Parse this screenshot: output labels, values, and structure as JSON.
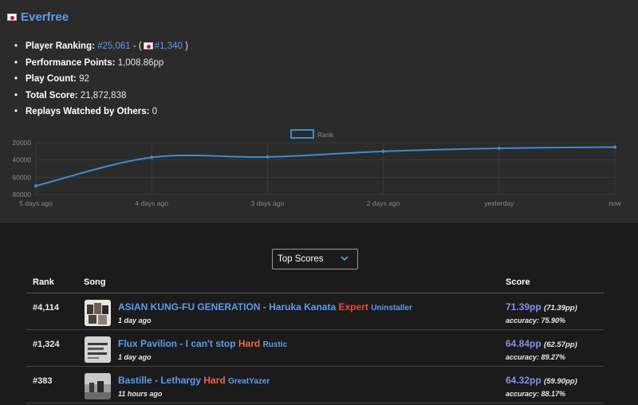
{
  "player": {
    "name": "Everfree",
    "stats": {
      "ranking_label": "Player Ranking:",
      "global_rank": "#25,061",
      "sep": " - (",
      "country_rank": "#1,340",
      "close": " )",
      "pp_label": "Performance Points:",
      "pp_value": "1,008.86pp",
      "playcount_label": "Play Count:",
      "playcount_value": "92",
      "score_label": "Total Score:",
      "score_value": "21,872,838",
      "replays_label": "Replays Watched by Others:",
      "replays_value": "0"
    }
  },
  "chart_data": {
    "type": "line",
    "title": "",
    "legend": [
      "Rank"
    ],
    "legend_placement": "top-center",
    "x": [
      "5 days ago",
      "4 days ago",
      "3 days ago",
      "2 days ago",
      "yesterday",
      "now"
    ],
    "series": [
      {
        "name": "Rank",
        "values": [
          70000,
          37000,
          36500,
          30000,
          26500,
          25061
        ]
      }
    ],
    "y_ticks": [
      20000,
      40000,
      60000,
      80000
    ],
    "ylim": [
      20000,
      80000
    ],
    "y_reversed": true,
    "grid": true,
    "line_color": "#3d8bd0"
  },
  "controls": {
    "dropdown_label": "Top Scores"
  },
  "table": {
    "headers": {
      "rank": "Rank",
      "song": "Song",
      "score": "Score"
    },
    "rows": [
      {
        "rank": "#4,114",
        "song": "ASIAN KUNG-FU GENERATION - Haruka Kanata",
        "difficulty": "Expert",
        "difficulty_color": "#e74c3c",
        "mapper": "Uninstaller",
        "time": "1 day ago",
        "pp": "71.39pp",
        "pp_weighted": "(71.39pp)",
        "accuracy": "accuracy: 75.90%"
      },
      {
        "rank": "#1,324",
        "song": "Flux Pavilion - I can't stop",
        "difficulty": "Hard",
        "difficulty_color": "#f0624d",
        "mapper": "Rustic",
        "time": "1 day ago",
        "pp": "64.84pp",
        "pp_weighted": "(62.57pp)",
        "accuracy": "accuracy: 89.27%"
      },
      {
        "rank": "#383",
        "song": "Bastille - Lethargy",
        "difficulty": "Hard",
        "difficulty_color": "#f0624d",
        "mapper": "GreatYazer",
        "time": "11 hours ago",
        "pp": "64.32pp",
        "pp_weighted": "(59.90pp)",
        "accuracy": "accuracy: 88.17%"
      }
    ]
  }
}
